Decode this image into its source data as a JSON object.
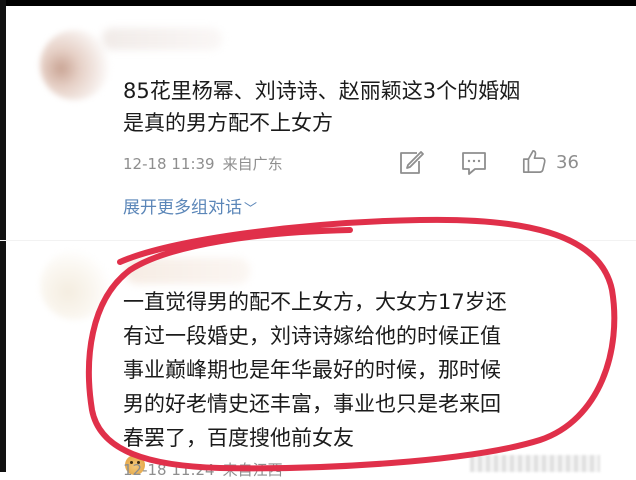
{
  "comment1": {
    "text_lines": [
      "85花里杨幂、刘诗诗、赵丽颖这3个的婚姻",
      "是真的男方配不上女方"
    ],
    "time": "12-18 11:39",
    "location": "来自广东",
    "like_count": "36",
    "expand_label": "展开更多组对话"
  },
  "comment2": {
    "text_lines": [
      "一直觉得男的配不上女方，大女方17岁还",
      "有过一段婚史，刘诗诗嫁给他的时候正值",
      "事业巅峰期也是年华最好的时候，那时候",
      "男的好老情史还丰富，事业也只是老来回",
      "春罢了，百度搜他前女友"
    ],
    "emoji": "doge-emoji",
    "time": "12-18 11:24",
    "location": "来自江西"
  },
  "colors": {
    "text": "#1b1b1b",
    "meta": "#8e8e8e",
    "link": "#5b86b8",
    "highlight_circle": "#e0304a"
  },
  "icons": [
    "edit-icon",
    "comment-icon",
    "thumbs-up-icon",
    "chevron-down-icon"
  ]
}
